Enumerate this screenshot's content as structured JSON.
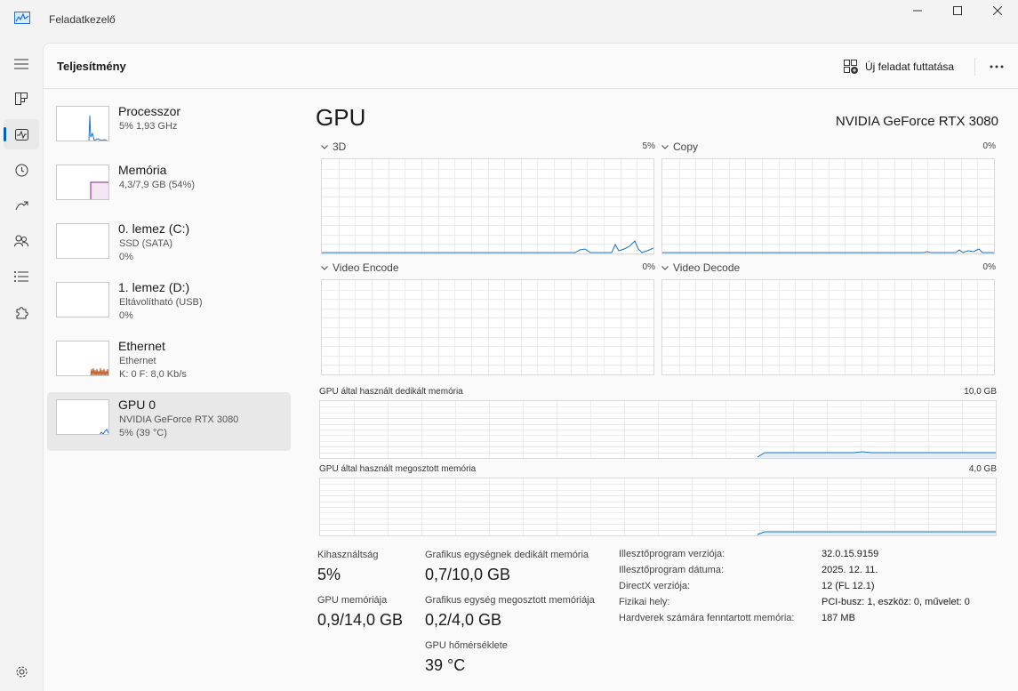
{
  "window": {
    "title": "Feladatkezelő"
  },
  "header": {
    "title": "Teljesítmény",
    "run_task_label": "Új feladat futtatása"
  },
  "devices": [
    {
      "name": "Processzor",
      "line1": "5% 1,93 GHz",
      "line2": "",
      "color": "#1a73c6"
    },
    {
      "name": "Memória",
      "line1": "4,3/7,9 GB (54%)",
      "line2": "",
      "color": "#8b1a8b"
    },
    {
      "name": "0. lemez (C:)",
      "line1": "SSD (SATA)",
      "line2": "0%",
      "color": "#4d9a06"
    },
    {
      "name": "1. lemez (D:)",
      "line1": "Eltávolítható (USB)",
      "line2": "0%",
      "color": "#4d9a06"
    },
    {
      "name": "Ethernet",
      "line1": "Ethernet",
      "line2": "K: 0 F: 8,0 Kb/s",
      "color": "#a0522d"
    },
    {
      "name": "GPU 0",
      "line1": "NVIDIA GeForce RTX 3080",
      "line2": "5% (39 °C)",
      "color": "#1a73c6"
    }
  ],
  "gpu": {
    "title": "GPU",
    "model": "NVIDIA GeForce RTX 3080",
    "engines": [
      {
        "name": "3D",
        "pct": "5%"
      },
      {
        "name": "Copy",
        "pct": "0%"
      },
      {
        "name": "Video Encode",
        "pct": "0%"
      },
      {
        "name": "Video Decode",
        "pct": "0%"
      }
    ],
    "dedicated_label": "GPU által használt dedikált memória",
    "dedicated_max": "10,0 GB",
    "shared_label": "GPU által használt megosztott memória",
    "shared_max": "4,0 GB",
    "accent": "#1a73c6"
  },
  "stats": {
    "util_label": "Kihasználtság",
    "util_value": "5%",
    "gpumem_label": "GPU memóriája",
    "gpumem_value": "0,9/14,0 GB",
    "ded_label": "Grafikus egységnek dedikált memória",
    "ded_value": "0,7/10,0 GB",
    "shr_label": "Grafikus egység megosztott memóriája",
    "shr_value": "0,2/4,0 GB",
    "temp_label": "GPU hőmérséklete",
    "temp_value": "39 °C"
  },
  "info": [
    {
      "k": "Illesztőprogram verziója:",
      "v": "32.0.15.9159"
    },
    {
      "k": "Illesztőprogram dátuma:",
      "v": "2025. 12. 11."
    },
    {
      "k": "DirectX verziója:",
      "v": "12 (FL 12.1)"
    },
    {
      "k": "Fizikai hely:",
      "v": "PCI-busz: 1, eszköz: 0, művelet: 0"
    },
    {
      "k": "Hardverek számára fenntartott memória:",
      "v": "187 MB"
    }
  ]
}
